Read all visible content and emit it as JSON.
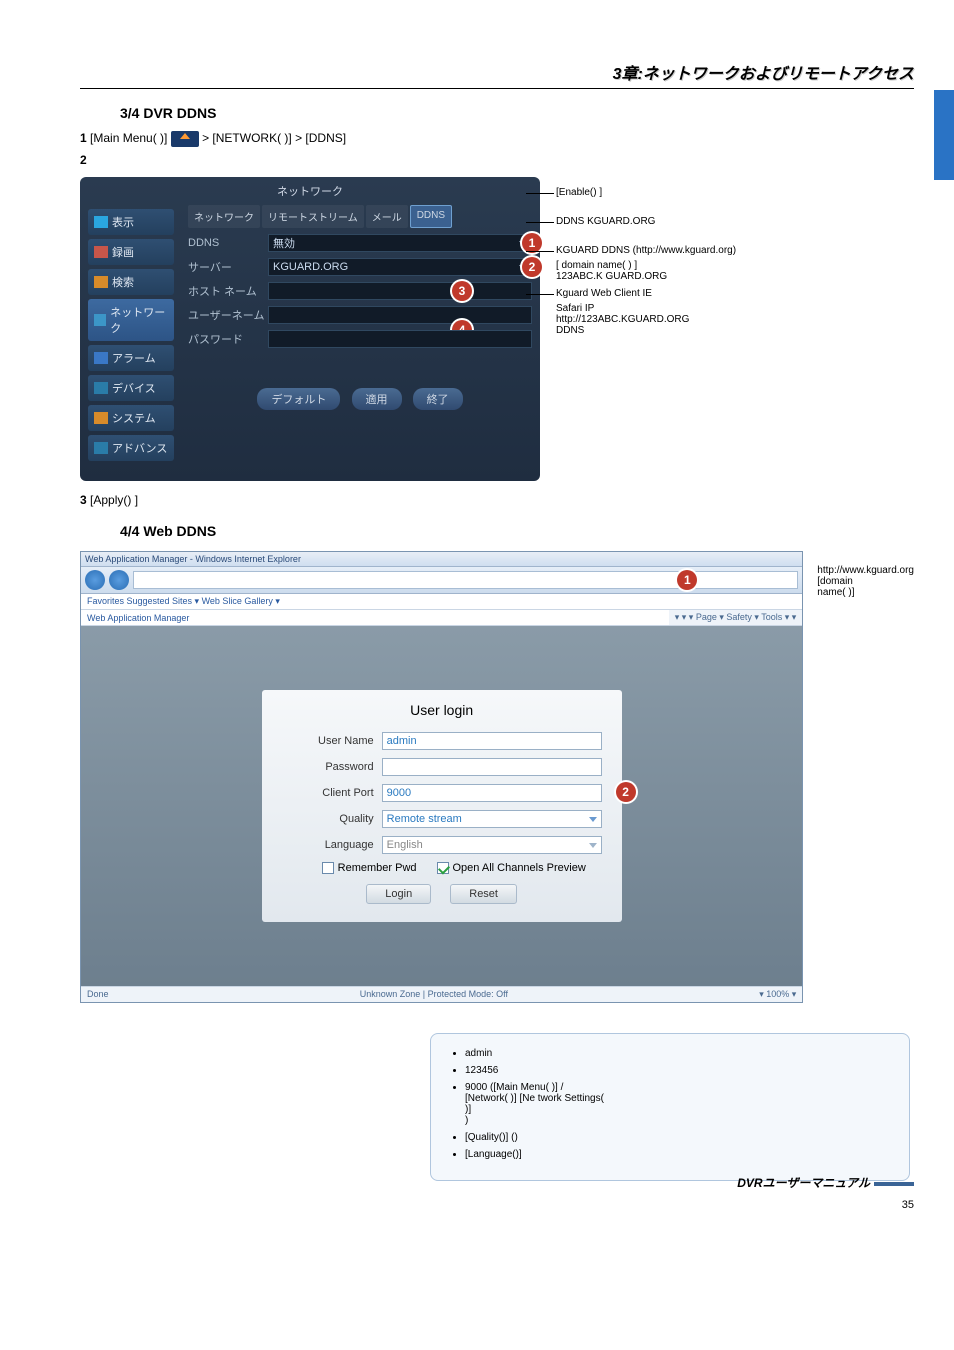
{
  "chapter": "3章:ネットワークおよびリモートアクセス",
  "section34": {
    "heading": "3/4  DVR             DDNS"
  },
  "step1": {
    "num": "1",
    "pre": " [Main Menu(                          )] ",
    "post": " > [NETWORK(                         )] > [DDNS]"
  },
  "step2": {
    "num": "2",
    "text": ""
  },
  "netui": {
    "title": "ネットワーク",
    "sidebar": {
      "display": "表示",
      "record": "録画",
      "search": "検索",
      "network": "ネットワーク",
      "alarm": "アラーム",
      "device": "デバイス",
      "system": "システム",
      "advance": "アドバンス"
    },
    "tabs": {
      "net": "ネットワーク",
      "remote": "リモートストリーム",
      "mail": "メール",
      "ddns": "DDNS"
    },
    "rows": {
      "ddns_label": "DDNS",
      "ddns_value": "無効",
      "server_label": "サーバー",
      "server_value": "KGUARD.ORG",
      "host_label": "ホスト ネーム",
      "user_label": "ユーザーネーム",
      "pass_label": "パスワード"
    },
    "buttons": {
      "default": "デフォルト",
      "apply": "適用",
      "exit": "終了"
    }
  },
  "notesA": {
    "n1": "[Enable()        ]",
    "n2": "DDNS                     KGUARD.ORG",
    "n3": "KGUARD DDNS                 (http://www.kguard.org)",
    "n3b": "[   domain name(                )   ]",
    "n3c": "                         123ABC.K         GUARD.ORG",
    "n4a": "         Kguard Web Client                                     IE",
    "n4b": "Safari                 IP",
    "n4c": "http://123ABC.KGUARD.ORG",
    "n4d": "DDNS"
  },
  "step3": {
    "num": "3",
    "text": " [Apply()        ]"
  },
  "section44": {
    "heading": "4/4  Web                  DDNS"
  },
  "ie": {
    "titlebar": "Web Application Manager - Windows Internet Explorer",
    "favorites": "Favorites     Suggested Sites ▾    Web Slice Gallery ▾",
    "tab": "Web Application Manager",
    "tools": "▾  ▾  ▾  Page ▾  Safety ▾  Tools ▾  ▾",
    "status_left": "Done",
    "status_mid": "Unknown Zone | Protected Mode: Off",
    "status_right": "▾  100%  ▾"
  },
  "login": {
    "title": "User login",
    "username_label": "User Name",
    "username_val": "admin",
    "password_label": "Password",
    "port_label": "Client Port",
    "port_val": "9000",
    "quality_label": "Quality",
    "quality_val": "Remote stream",
    "lang_label": "Language",
    "lang_val": "English",
    "remember": "Remember Pwd",
    "openall": "Open All Channels Preview",
    "login_btn": "Login",
    "reset_btn": "Reset"
  },
  "notesB": {
    "l1": "http://www.kguard.org",
    "l2": "                    [domain",
    "l3": "name(               )]"
  },
  "notebox": {
    "li1": "                     admin",
    "li2": "                     123456",
    "li3": "                             9000 ([Main Menu(                              )] /",
    "li3b": "[Network(                       )]         [Ne    twork Settings(",
    "li3c": "             )]",
    "li3d": "                             )",
    "li4": "[Quality()]                                        ()",
    "li5": "[Language()]"
  },
  "footer": "DVRユーザーマニュアル",
  "page": "35"
}
